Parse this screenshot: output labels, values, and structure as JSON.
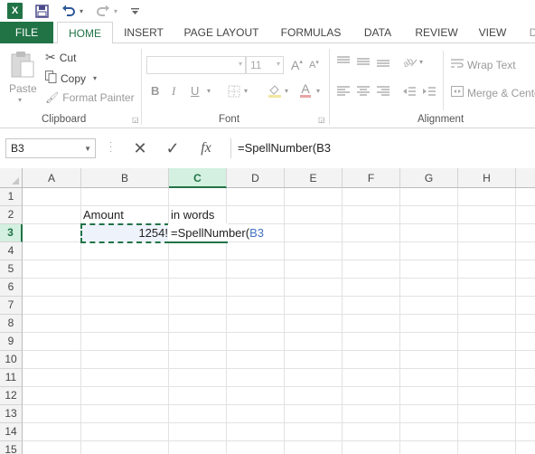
{
  "app": {
    "logo_text": "X",
    "accent": "#217346",
    "ref_color": "#4472c4"
  },
  "qat": {
    "icons": [
      "excel-logo-icon",
      "save-icon",
      "undo-icon",
      "redo-icon",
      "customize-qat-icon"
    ]
  },
  "tabs": [
    {
      "label": "FILE"
    },
    {
      "label": "HOME"
    },
    {
      "label": "INSERT"
    },
    {
      "label": "PAGE LAYOUT"
    },
    {
      "label": "FORMULAS"
    },
    {
      "label": "DATA"
    },
    {
      "label": "REVIEW"
    },
    {
      "label": "VIEW"
    }
  ],
  "ribbon": {
    "clipboard": {
      "label": "Clipboard",
      "paste": "Paste",
      "cut": "Cut",
      "copy": "Copy",
      "format_painter": "Format Painter"
    },
    "font": {
      "label": "Font",
      "font_name": "",
      "font_size": "11",
      "bold": "B",
      "italic": "I",
      "underline": "U",
      "grow": "A",
      "shrink": "A",
      "font_color": "A"
    },
    "alignment": {
      "label": "Alignment",
      "wrap_text": "Wrap Text",
      "merge": "Merge & Center"
    }
  },
  "formula_bar": {
    "name_box": "B3",
    "cancel": "✕",
    "enter": "✓",
    "fx": "fx",
    "formula": "=SpellNumber(B3"
  },
  "grid": {
    "columns": [
      "A",
      "B",
      "C",
      "D",
      "E",
      "F",
      "G",
      "H"
    ],
    "selected_column": "C",
    "rows": [
      "1",
      "2",
      "3",
      "4",
      "5",
      "6",
      "7",
      "8",
      "9",
      "10",
      "11",
      "12",
      "13",
      "14",
      "15"
    ],
    "selected_row": "3",
    "cells": {
      "B2": "Amount",
      "C2": "in words",
      "B3": "1254!",
      "C3_text": "=SpellNumber(",
      "C3_ref": "B3"
    }
  }
}
